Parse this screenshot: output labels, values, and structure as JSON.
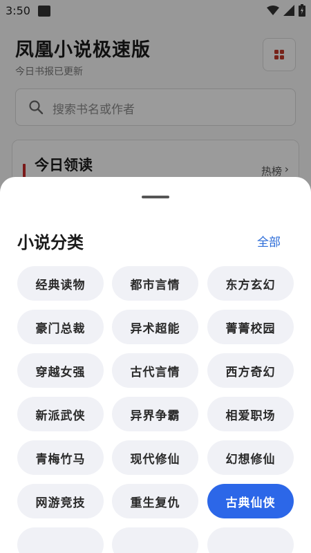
{
  "status_bar": {
    "time": "3:50"
  },
  "header": {
    "title": "凤凰小说极速版",
    "subtitle": "今日书报已更新"
  },
  "search": {
    "placeholder": "搜索书名或作者"
  },
  "reading_card": {
    "title": "今日领读",
    "hot_label": "热榜"
  },
  "sheet": {
    "title": "小说分类",
    "view_all": "全部",
    "categories": [
      "经典读物",
      "都市言情",
      "东方玄幻",
      "豪门总裁",
      "异术超能",
      "菁菁校园",
      "穿越女强",
      "古代言情",
      "西方奇幻",
      "新派武侠",
      "异界争霸",
      "相爱职场",
      "青梅竹马",
      "现代修仙",
      "幻想修仙",
      "网游竞技",
      "重生复仇",
      "古典仙侠"
    ],
    "selected_category": "古典仙侠"
  },
  "colors": {
    "accent_blue": "#2c67e8",
    "brand_red": "#c62828",
    "chip_bg": "#f0f1f6"
  }
}
